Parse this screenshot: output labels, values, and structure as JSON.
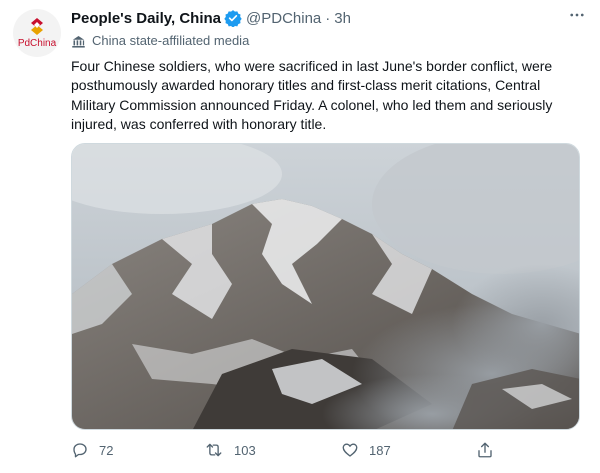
{
  "account": {
    "avatar_brand": "PdChina",
    "name": "People's Daily, China",
    "handle": "@PDChina",
    "separator": "·",
    "time": "3h",
    "label": "China state-affiliated media"
  },
  "tweet": {
    "text": "Four Chinese soldiers, who were sacrificed in last June's border conflict, were posthumously awarded honorary titles and first-class merit citations, Central Military Commission announced Friday. A colonel, who led them and seriously injured, was conferred with honorary title."
  },
  "icons": {
    "more": "more-icon",
    "verified": "verified-badge-icon",
    "label": "building-icon",
    "reply": "reply-icon",
    "retweet": "retweet-icon",
    "like": "like-icon",
    "share": "share-icon"
  },
  "actions": {
    "reply_count": "72",
    "retweet_count": "103",
    "like_count": "187"
  },
  "colors": {
    "brand_red": "#c8102e",
    "verified_blue": "#1d9bf0",
    "secondary_text": "#536471"
  }
}
